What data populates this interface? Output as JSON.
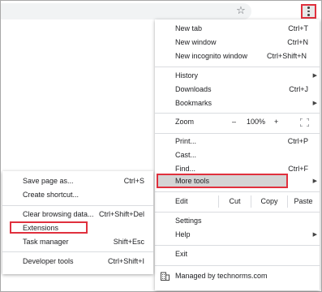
{
  "toolbar": {
    "star_icon": "star-icon",
    "menu_icon": "vertical-ellipsis-icon"
  },
  "menu": {
    "new_tab": {
      "label": "New tab",
      "shortcut": "Ctrl+T"
    },
    "new_window": {
      "label": "New window",
      "shortcut": "Ctrl+N"
    },
    "new_incognito": {
      "label": "New incognito window",
      "shortcut": "Ctrl+Shift+N"
    },
    "history": {
      "label": "History"
    },
    "downloads": {
      "label": "Downloads",
      "shortcut": "Ctrl+J"
    },
    "bookmarks": {
      "label": "Bookmarks"
    },
    "zoom": {
      "label": "Zoom",
      "minus": "–",
      "value": "100%",
      "plus": "+"
    },
    "print": {
      "label": "Print...",
      "shortcut": "Ctrl+P"
    },
    "cast": {
      "label": "Cast..."
    },
    "find": {
      "label": "Find...",
      "shortcut": "Ctrl+F"
    },
    "more_tools": {
      "label": "More tools"
    },
    "edit": {
      "label": "Edit",
      "cut": "Cut",
      "copy": "Copy",
      "paste": "Paste"
    },
    "settings": {
      "label": "Settings"
    },
    "help": {
      "label": "Help"
    },
    "exit": {
      "label": "Exit"
    },
    "managed": {
      "label": "Managed by technorms.com"
    }
  },
  "submenu": {
    "save_page": {
      "label": "Save page as...",
      "shortcut": "Ctrl+S"
    },
    "create_shortcut": {
      "label": "Create shortcut..."
    },
    "clear_browsing": {
      "label": "Clear browsing data...",
      "shortcut": "Ctrl+Shift+Del"
    },
    "extensions": {
      "label": "Extensions"
    },
    "task_manager": {
      "label": "Task manager",
      "shortcut": "Shift+Esc"
    },
    "developer_tools": {
      "label": "Developer tools",
      "shortcut": "Ctrl+Shift+I"
    }
  },
  "colors": {
    "highlight_border": "#e0303d",
    "hover_background": "#d4d4d4",
    "separator": "#dadce0"
  }
}
